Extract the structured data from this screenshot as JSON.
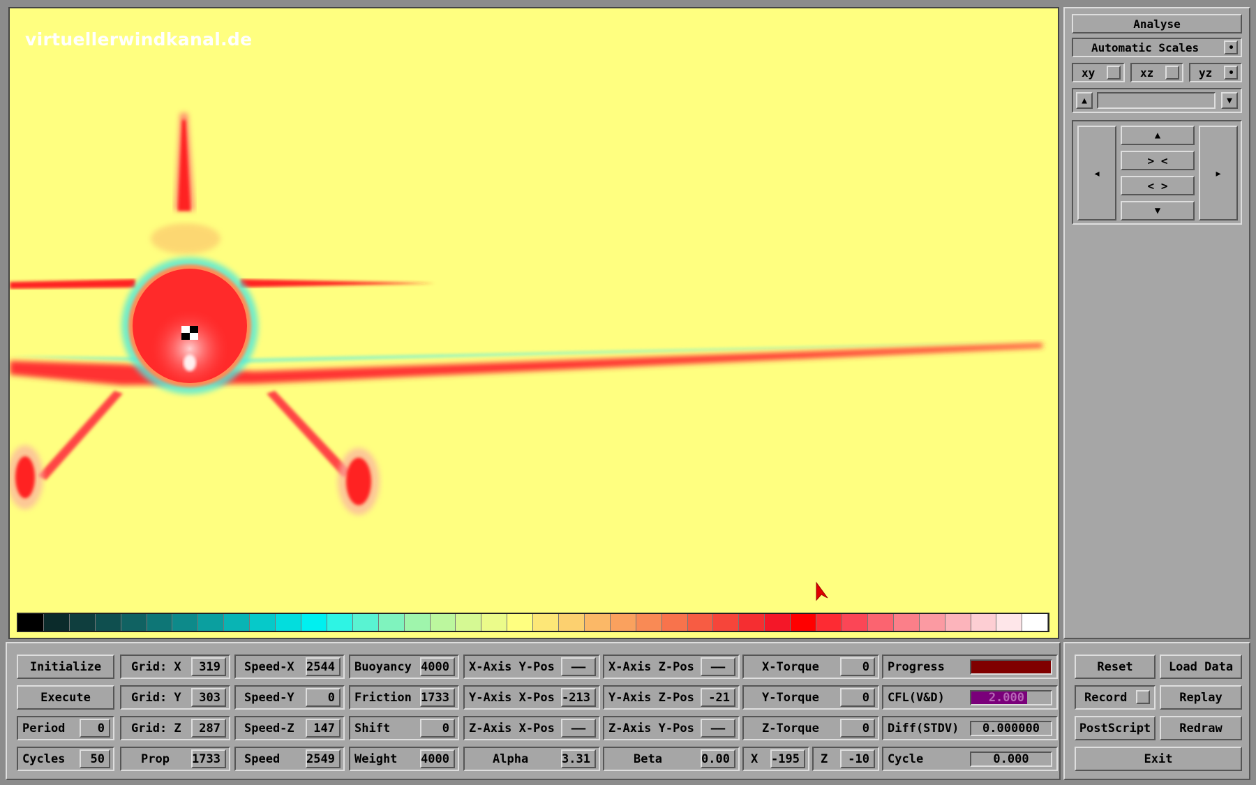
{
  "viewport": {
    "watermark": "virtuellerwindkanal.de",
    "colorbar": [
      "#000000",
      "#0b2b2b",
      "#0f3e3e",
      "#0f4f4f",
      "#106262",
      "#0e7676",
      "#0d8a8a",
      "#0b9f9f",
      "#09b4b4",
      "#06c9c9",
      "#03dddd",
      "#00f0f0",
      "#2ef4e4",
      "#59f3d2",
      "#7ff3be",
      "#9ff5ac",
      "#bcf79e",
      "#d5f993",
      "#ebfb8a",
      "#ffff80",
      "#fde777",
      "#fcd06f",
      "#fbb867",
      "#faa15e",
      "#f98a55",
      "#f8734c",
      "#f75c43",
      "#f6453a",
      "#f52e31",
      "#f41728",
      "#ff0000",
      "#fd2b33",
      "#fb4656",
      "#fb6470",
      "#fb7f89",
      "#fb9aa2",
      "#fcb4bb",
      "#fdced3",
      "#fee6e9",
      "#ffffff"
    ]
  },
  "right_panel": {
    "analyse": "Analyse",
    "automatic_scales": "Automatic Scales",
    "planes": [
      {
        "label": "xy",
        "selected": false
      },
      {
        "label": "xz",
        "selected": false
      },
      {
        "label": "yz",
        "selected": true
      }
    ],
    "up_arrow": "▲",
    "down_arrow": "▼",
    "left_arrow": "◂",
    "right_arrow": "▸",
    "zoom_in": "> <",
    "zoom_out": "< >"
  },
  "bottom": {
    "initialize": "Initialize",
    "execute": "Execute",
    "period_label": "Period",
    "period_value": "0",
    "cycles_label": "Cycles",
    "cycles_value": "50",
    "gridx_label": "Grid: X",
    "gridx_value": "319",
    "gridy_label": "Grid: Y",
    "gridy_value": "303",
    "gridz_label": "Grid: Z",
    "gridz_value": "287",
    "prop_label": "Prop",
    "prop_value": "1733",
    "speedx_label": "Speed-X",
    "speedx_value": "2544",
    "speedy_label": "Speed-Y",
    "speedy_value": "0",
    "speedz_label": "Speed-Z",
    "speedz_value": "147",
    "speed_label": "Speed",
    "speed_value": "2549",
    "buoyancy_label": "Buoyancy",
    "buoyancy_value": "4000",
    "friction_label": "Friction",
    "friction_value": "1733",
    "shift_label": "Shift",
    "shift_value": "0",
    "weight_label": "Weight",
    "weight_value": "4000",
    "xaxis_ypos_label": "X-Axis Y-Pos",
    "xaxis_ypos_value": "——",
    "yaxis_xpos_label": "Y-Axis X-Pos",
    "yaxis_xpos_value": "-213",
    "zaxis_xpos_label": "Z-Axis X-Pos",
    "zaxis_xpos_value": "——",
    "alpha_label": "Alpha",
    "alpha_value": "3.31",
    "xaxis_zpos_label": "X-Axis Z-Pos",
    "xaxis_zpos_value": "——",
    "yaxis_zpos_label": "Y-Axis Z-Pos",
    "yaxis_zpos_value": "-21",
    "zaxis_ypos_label": "Z-Axis Y-Pos",
    "zaxis_ypos_value": "——",
    "beta_label": "Beta",
    "beta_value": "0.00",
    "xtorque_label": "X-Torque",
    "xtorque_value": "0",
    "ytorque_label": "Y-Torque",
    "ytorque_value": "0",
    "ztorque_label": "Z-Torque",
    "ztorque_value": "0",
    "x_label": "X",
    "x_value": "-195",
    "z_label": "Z",
    "z_value": "-10",
    "progress_label": "Progress",
    "progress_fraction": 1.0,
    "progress_color": "#800000",
    "cfl_label": "CFL(V&D)",
    "cfl_value": "2.000",
    "cfl_color": "#7a007a",
    "diff_label": "Diff(STDV)",
    "diff_value": "0.000000",
    "cycle_label": "Cycle",
    "cycle_value": "0.000",
    "reset": "Reset",
    "load_data": "Load Data",
    "record": "Record",
    "replay": "Replay",
    "postscript": "PostScript",
    "redraw": "Redraw",
    "exit": "Exit"
  }
}
